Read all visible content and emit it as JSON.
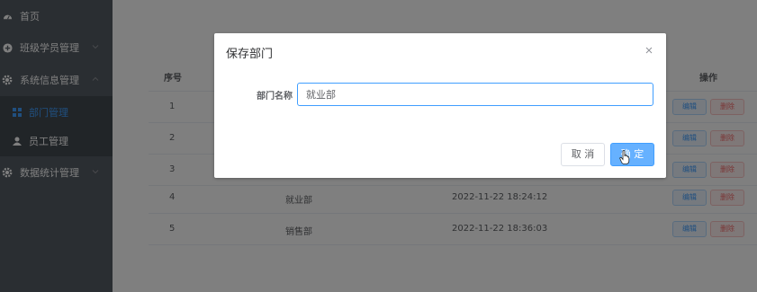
{
  "sidebar": {
    "items": [
      {
        "label": "首页",
        "icon": "dashboard-icon"
      },
      {
        "label": "班级学员管理",
        "icon": "plus-circle-icon"
      },
      {
        "label": "系统信息管理",
        "icon": "gear-icon",
        "expanded": true
      },
      {
        "label": "数据统计管理",
        "icon": "gear-icon"
      }
    ],
    "subitems": [
      {
        "label": "部门管理",
        "icon": "grid-icon",
        "active": true
      },
      {
        "label": "员工管理",
        "icon": "user-icon"
      }
    ]
  },
  "table": {
    "headers": {
      "index": "序号",
      "actions": "操作"
    },
    "edit_label": "编辑",
    "delete_label": "删除",
    "rows": [
      {
        "index": "1",
        "name": "",
        "time": ""
      },
      {
        "index": "2",
        "name": "",
        "time": ""
      },
      {
        "index": "3",
        "name": "",
        "time": ""
      },
      {
        "index": "4",
        "name": "就业部",
        "time": "2022-11-22 18:24:12"
      },
      {
        "index": "5",
        "name": "销售部",
        "time": "2022-11-22 18:36:03"
      }
    ]
  },
  "dialog": {
    "title": "保存部门",
    "field_label": "部门名称",
    "field_value": "就业部",
    "cancel_label": "取 消",
    "ok_label": "确 定"
  },
  "colors": {
    "sidebar_bg": "#545c64",
    "accent": "#409eff",
    "danger": "#f56c6c"
  }
}
